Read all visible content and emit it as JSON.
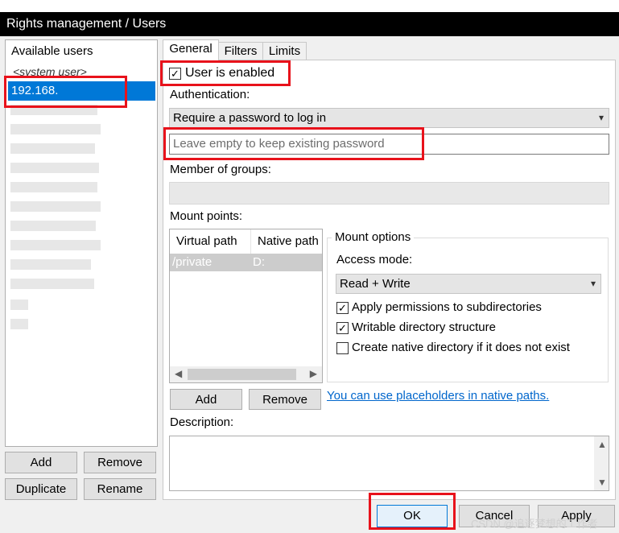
{
  "window": {
    "title": "Rights management / Users"
  },
  "users": {
    "header": "Available users",
    "system_user": "<system user>",
    "selected_user": "192.168."
  },
  "left_buttons": {
    "add": "Add",
    "remove": "Remove",
    "duplicate": "Duplicate",
    "rename": "Rename"
  },
  "tabs": [
    "General",
    "Filters",
    "Limits"
  ],
  "general": {
    "user_enabled_label": "User is enabled",
    "user_enabled_checked": true,
    "authentication_label": "Authentication:",
    "authentication_value": "Require a password to log in",
    "password_placeholder": "Leave empty to keep existing password",
    "groups_label": "Member of groups:",
    "mount_points_label": "Mount points:",
    "mount_columns": [
      "Virtual path",
      "Native path"
    ],
    "mount_rows": [
      {
        "virtual": "/private",
        "native": "D:"
      }
    ],
    "mount_add": "Add",
    "mount_remove": "Remove",
    "placeholders_link": "You can use placeholders in native paths.",
    "description_label": "Description:"
  },
  "mount_options": {
    "title": "Mount options",
    "access_mode_label": "Access mode:",
    "access_mode_value": "Read + Write",
    "options": [
      {
        "label": "Apply permissions to subdirectories",
        "checked": true
      },
      {
        "label": "Writable directory structure",
        "checked": true
      },
      {
        "label": "Create native directory if it does not exist",
        "checked": false
      }
    ]
  },
  "dialog_buttons": {
    "ok": "OK",
    "cancel": "Cancel",
    "apply": "Apply"
  },
  "watermark": "CSDN @追逐梦想的工作者",
  "colors": {
    "highlight": "#0078d7",
    "annotation": "#e8121b",
    "link": "#0066cc"
  }
}
